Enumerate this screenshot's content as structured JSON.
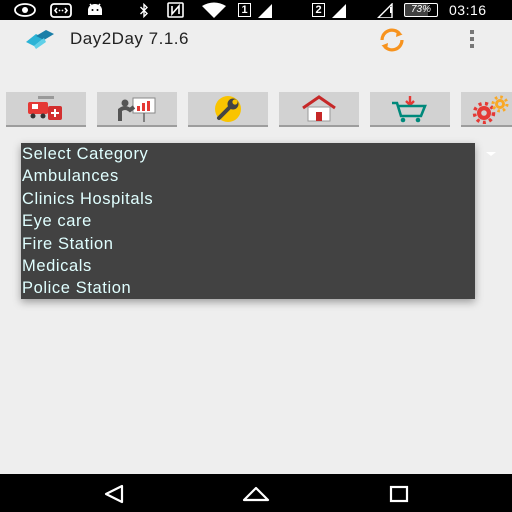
{
  "status_bar": {
    "sim1": "1",
    "sim2": "2",
    "battery": "73%",
    "time": "03:16",
    "icons": [
      "eye-icon",
      "cast-icon",
      "android-debug-icon",
      "bluetooth-icon",
      "nfc-icon",
      "wifi-icon",
      "signal-icon"
    ]
  },
  "app_bar": {
    "title": "Day2Day 7.1.6",
    "sync_color": "#f7931e",
    "icons": [
      "app-logo-icon",
      "sync-icon",
      "overflow-menu-icon"
    ]
  },
  "toolbar": {
    "buttons": [
      {
        "icon": "emergency-icon"
      },
      {
        "icon": "presentation-icon"
      },
      {
        "icon": "wrench-icon"
      },
      {
        "icon": "home-icon"
      },
      {
        "icon": "shopping-cart-icon"
      },
      {
        "icon": "settings-gears-icon"
      }
    ]
  },
  "category_dropdown": {
    "options": [
      "Select Category",
      "Ambulances",
      "Clinics Hospitals",
      "Eye care",
      "Fire Station",
      "Medicals",
      "Police Station"
    ],
    "background": "#424242",
    "text_color": "#e0ffff"
  },
  "nav_bar": {
    "icons": [
      "back-icon",
      "home-nav-icon",
      "recents-icon"
    ]
  }
}
